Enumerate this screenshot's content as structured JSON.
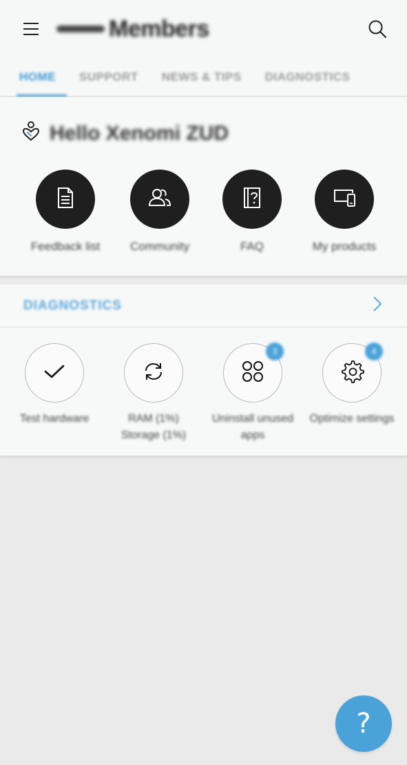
{
  "app": {
    "title": "Members",
    "menu_icon": "hamburger-menu-icon",
    "search_icon": "search-icon"
  },
  "tabs": [
    {
      "label": "HOME",
      "active": true
    },
    {
      "label": "SUPPORT",
      "active": false
    },
    {
      "label": "NEWS & TIPS",
      "active": false
    },
    {
      "label": "DIAGNOSTICS",
      "active": false
    }
  ],
  "welcome": {
    "icon": "heart-person-icon",
    "greeting": "Hello Xenomi ZUD"
  },
  "shortcuts": [
    {
      "label": "Feedback list",
      "icon": "document-icon"
    },
    {
      "label": "Community",
      "icon": "people-icon"
    },
    {
      "label": "FAQ",
      "icon": "faq-book-icon"
    },
    {
      "label": "My products",
      "icon": "devices-icon"
    }
  ],
  "diagnostics": {
    "title": "DIAGNOSTICS",
    "items": [
      {
        "label": "Test hardware",
        "icon": "check-icon",
        "badge": ""
      },
      {
        "label": "RAM (1%)",
        "label2": "Storage (1%)",
        "icon": "sync-icon",
        "badge": ""
      },
      {
        "label": "Uninstall unused",
        "label2": "apps",
        "icon": "apps-grid-icon",
        "badge": "3"
      },
      {
        "label": "Optimize settings",
        "icon": "gear-icon",
        "badge": "4"
      }
    ]
  },
  "fab": {
    "label": "?",
    "icon": "help-icon"
  },
  "colors": {
    "accent": "#3e9bd6",
    "badge": "#4aa3da",
    "fab": "#4aa3d8",
    "dark_circle": "#1f1f1f",
    "background": "#ebeaea"
  }
}
